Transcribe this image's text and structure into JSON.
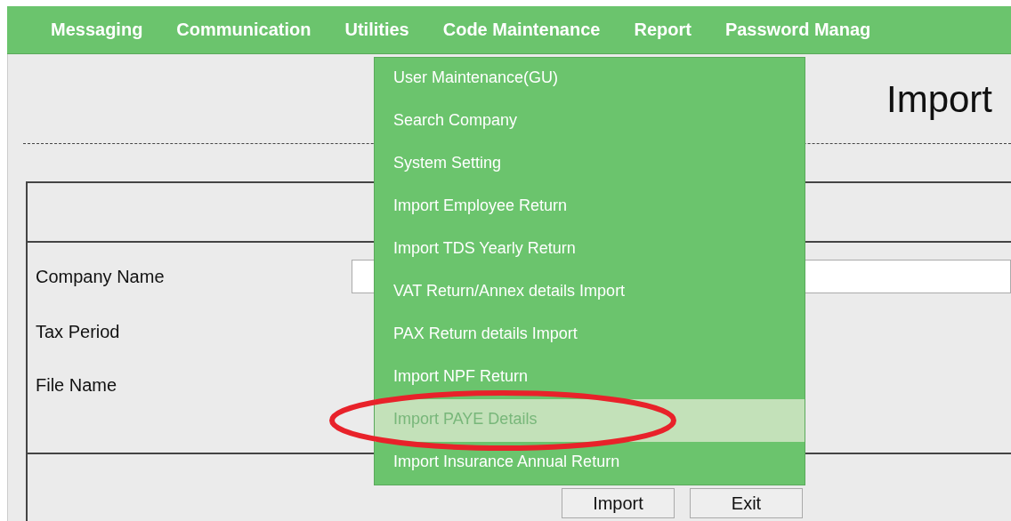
{
  "menu_bar": [
    "Messaging",
    "Communication",
    "Utilities",
    "Code Maintenance",
    "Report",
    "Password Manag"
  ],
  "page_title": "Import",
  "form": {
    "fields": [
      {
        "label": "Company Name",
        "kind": "input"
      },
      {
        "label": "Tax Period",
        "kind": "none"
      },
      {
        "label": "File Name",
        "kind": "none"
      }
    ],
    "buttons": [
      "Import",
      "Exit"
    ]
  },
  "dropdown": [
    {
      "label": "User Maintenance(GU)",
      "selected": false
    },
    {
      "label": "Search Company",
      "selected": false
    },
    {
      "label": "System Setting",
      "selected": false
    },
    {
      "label": "Import Employee Return",
      "selected": false
    },
    {
      "label": "Import TDS Yearly Return",
      "selected": false
    },
    {
      "label": "VAT Return/Annex details Import",
      "selected": false
    },
    {
      "label": "PAX Return details Import",
      "selected": false
    },
    {
      "label": "Import NPF Return",
      "selected": false
    },
    {
      "label": "Import PAYE Details",
      "selected": true
    },
    {
      "label": "Import Insurance Annual Return",
      "selected": false
    }
  ]
}
